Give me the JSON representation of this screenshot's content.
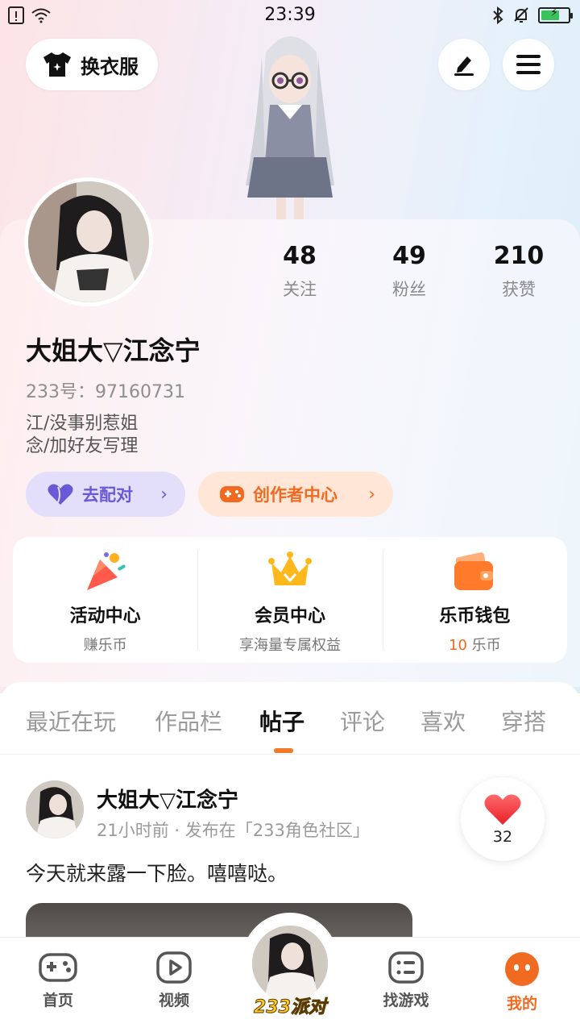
{
  "status_bar": {
    "time": "23:39"
  },
  "header": {
    "outfit_label": "换衣服"
  },
  "profile": {
    "username": "大姐大▽江念宁",
    "uid": "233号：97160731",
    "bio_line1": "江/没事别惹姐",
    "bio_line2": "念/加好友写理",
    "stats": [
      {
        "value": "48",
        "label": "关注"
      },
      {
        "value": "49",
        "label": "粉丝"
      },
      {
        "value": "210",
        "label": "获赞"
      }
    ],
    "match_label": "去配对",
    "creator_label": "创作者中心"
  },
  "features": [
    {
      "title": "活动中心",
      "subtitle": "赚乐币"
    },
    {
      "title": "会员中心",
      "subtitle": "享海量专属权益"
    },
    {
      "title": "乐币钱包",
      "subtitle_value": "10",
      "subtitle_unit": "乐币"
    }
  ],
  "tabs": [
    "最近在玩",
    "作品栏",
    "帖子",
    "评论",
    "喜欢",
    "穿搭"
  ],
  "active_tab": "帖子",
  "post": {
    "author": "大姐大▽江念宁",
    "meta": "21小时前 · 发布在「233角色社区」",
    "text": "今天就来露一下脸。嘻嘻哒。",
    "likes": "32"
  },
  "bottom_nav": {
    "items": [
      "首页",
      "视频",
      "找游戏",
      "我的"
    ],
    "center_label": "233派对",
    "active": "我的"
  },
  "colors": {
    "accent": "#f06a21",
    "match_purple": "#6a59d6"
  }
}
